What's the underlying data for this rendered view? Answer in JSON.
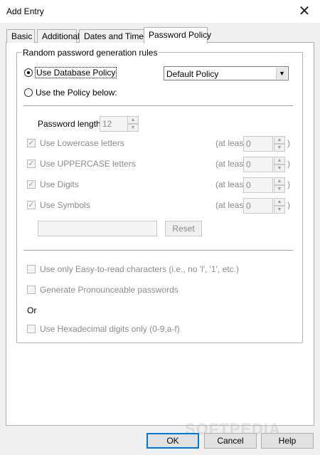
{
  "window": {
    "title": "Add Entry"
  },
  "tabs": [
    {
      "label": "Basic"
    },
    {
      "label": "Additional"
    },
    {
      "label": "Dates and Times"
    },
    {
      "label": "Password Policy"
    }
  ],
  "group": {
    "label": "Random password generation rules",
    "use_db_policy": "Use Database Policy",
    "policy_select_value": "Default Policy",
    "use_policy_below": "Use the Policy below:",
    "password_length_label": "Password length:",
    "password_length_value": "12",
    "rules": [
      {
        "label": "Use Lowercase letters",
        "at_least": "(at least",
        "value": "0",
        "close": ")"
      },
      {
        "label": "Use UPPERCASE letters",
        "at_least": "(at least",
        "value": "0",
        "close": ")"
      },
      {
        "label": "Use Digits",
        "at_least": "(at least",
        "value": "0",
        "close": ")"
      },
      {
        "label": "Use Symbols",
        "at_least": "(at least",
        "value": "0",
        "close": ")"
      }
    ],
    "reset_label": "Reset",
    "easy_to_read": "Use only Easy-to-read characters (i.e., no  'l', '1', etc.)",
    "pronounceable": "Generate Pronounceable passwords",
    "or_label": "Or",
    "hex_only": "Use Hexadecimal digits only (0-9,a-f)"
  },
  "buttons": {
    "ok": "OK",
    "cancel": "Cancel",
    "help": "Help"
  },
  "watermark": "SOFTPEDIA"
}
